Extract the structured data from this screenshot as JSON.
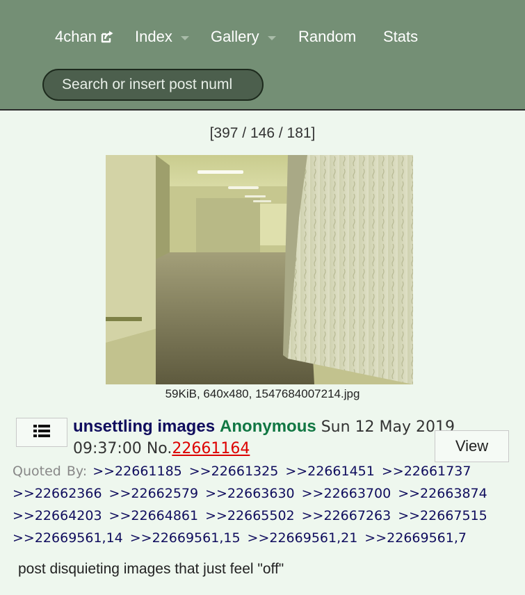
{
  "nav": {
    "logo": "4chan",
    "index": "Index",
    "gallery": "Gallery",
    "random": "Random",
    "stats": "Stats"
  },
  "search": {
    "placeholder": "Search or insert post numl"
  },
  "thread_stats": "[397 / 146 / 181]",
  "file": {
    "info": "59KiB, 640x480, 1547684007214.jpg"
  },
  "post": {
    "subject": "unsettling images",
    "name": "Anonymous",
    "date": "Sun 12 May 2019",
    "time": "09:37:00",
    "no_label": "No.",
    "number": "22661164",
    "view_label": "View",
    "quoted_by_label": "Quoted By:",
    "quoted_by": [
      ">>22661185",
      ">>22661325",
      ">>22661451",
      ">>22661737",
      ">>22662366",
      ">>22662579",
      ">>22663630",
      ">>22663700",
      ">>22663874",
      ">>22664203",
      ">>22664861",
      ">>22665502",
      ">>22667263",
      ">>22667515",
      ">>22669561,14",
      ">>22669561,15",
      ">>22669561,21",
      ">>22669561,7"
    ],
    "comment": "post disquieting images that just feel \"off\""
  },
  "colors": {
    "header_bg": "#748f75",
    "page_bg": "#eef7ee",
    "subject": "#0f0c5d",
    "name": "#117743",
    "post_number": "#dd0000"
  },
  "icons": [
    "external-link-icon",
    "chevron-down-icon",
    "list-menu-icon"
  ]
}
